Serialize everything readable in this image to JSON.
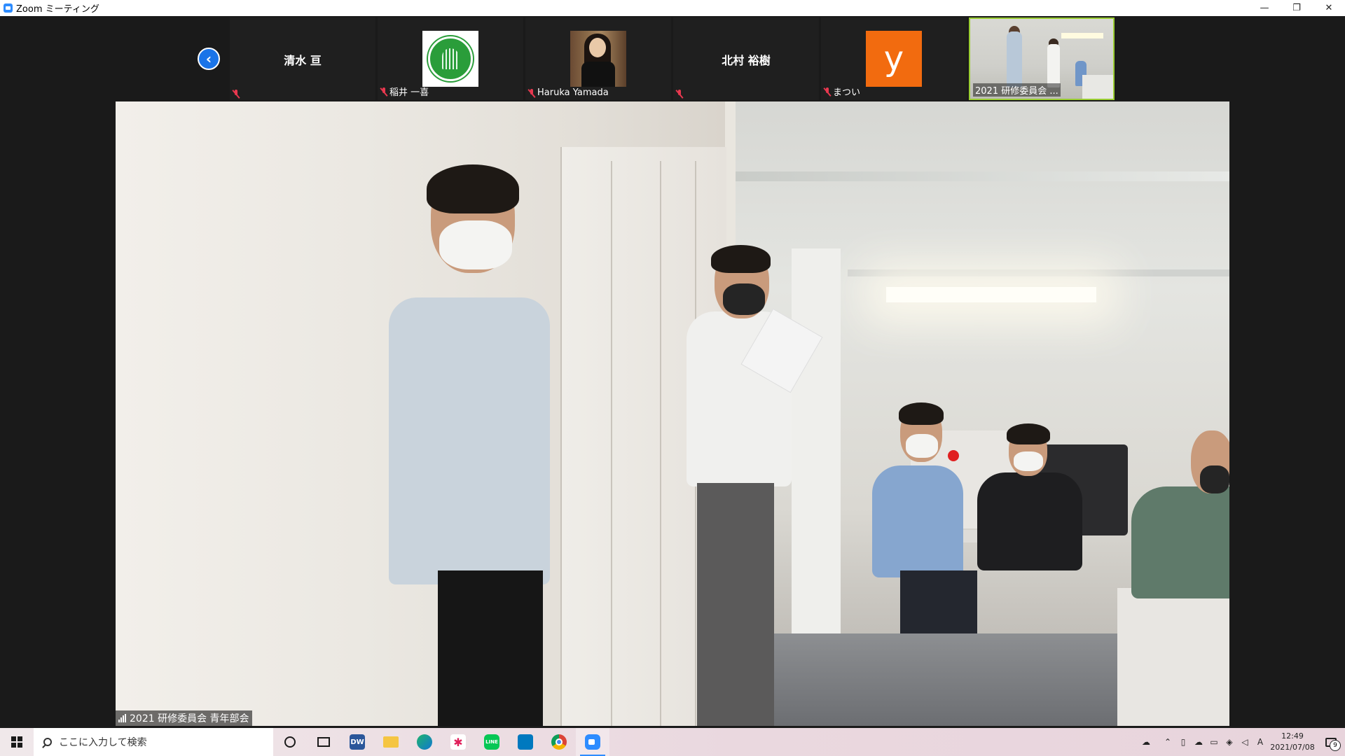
{
  "window": {
    "title": "Zoom ミーティング",
    "controls": {
      "minimize": "—",
      "restore": "❐",
      "close": "✕"
    }
  },
  "participants": {
    "prev_icon": "‹",
    "tiles": [
      {
        "name": "清水 亘",
        "display": "name",
        "muted": true,
        "label": ""
      },
      {
        "name": "稲井 一喜",
        "display": "logo-green",
        "muted": true,
        "label": "稲井 一喜"
      },
      {
        "name": "Haruka Yamada",
        "display": "photo",
        "muted": true,
        "label": "Haruka Yamada"
      },
      {
        "name": "北村 裕樹",
        "display": "name",
        "muted": true,
        "label": ""
      },
      {
        "name": "まつい",
        "display": "letter",
        "letter": "y",
        "muted": true,
        "label": "まつい"
      },
      {
        "name": "2021 研修委員会 ...",
        "display": "video",
        "muted": false,
        "label": "2021 研修委員会 ..."
      }
    ]
  },
  "main_video": {
    "label": "2021 研修委員会 青年部会"
  },
  "taskbar": {
    "search_placeholder": "ここに入力して検索",
    "apps": [
      "cortana",
      "task-view",
      "dreamweaver",
      "file-explorer",
      "edge",
      "slack",
      "line",
      "trello",
      "chrome",
      "zoom"
    ],
    "dw_label": "DW",
    "line_label": "LINE",
    "ime": "A",
    "time": "12:49",
    "date": "2021/07/08",
    "notifications": "9"
  },
  "colors": {
    "active_border": "#9acd32",
    "zoom_blue": "#2d8cff",
    "muted_red": "#e8384f",
    "orange": "#f26b0f"
  }
}
